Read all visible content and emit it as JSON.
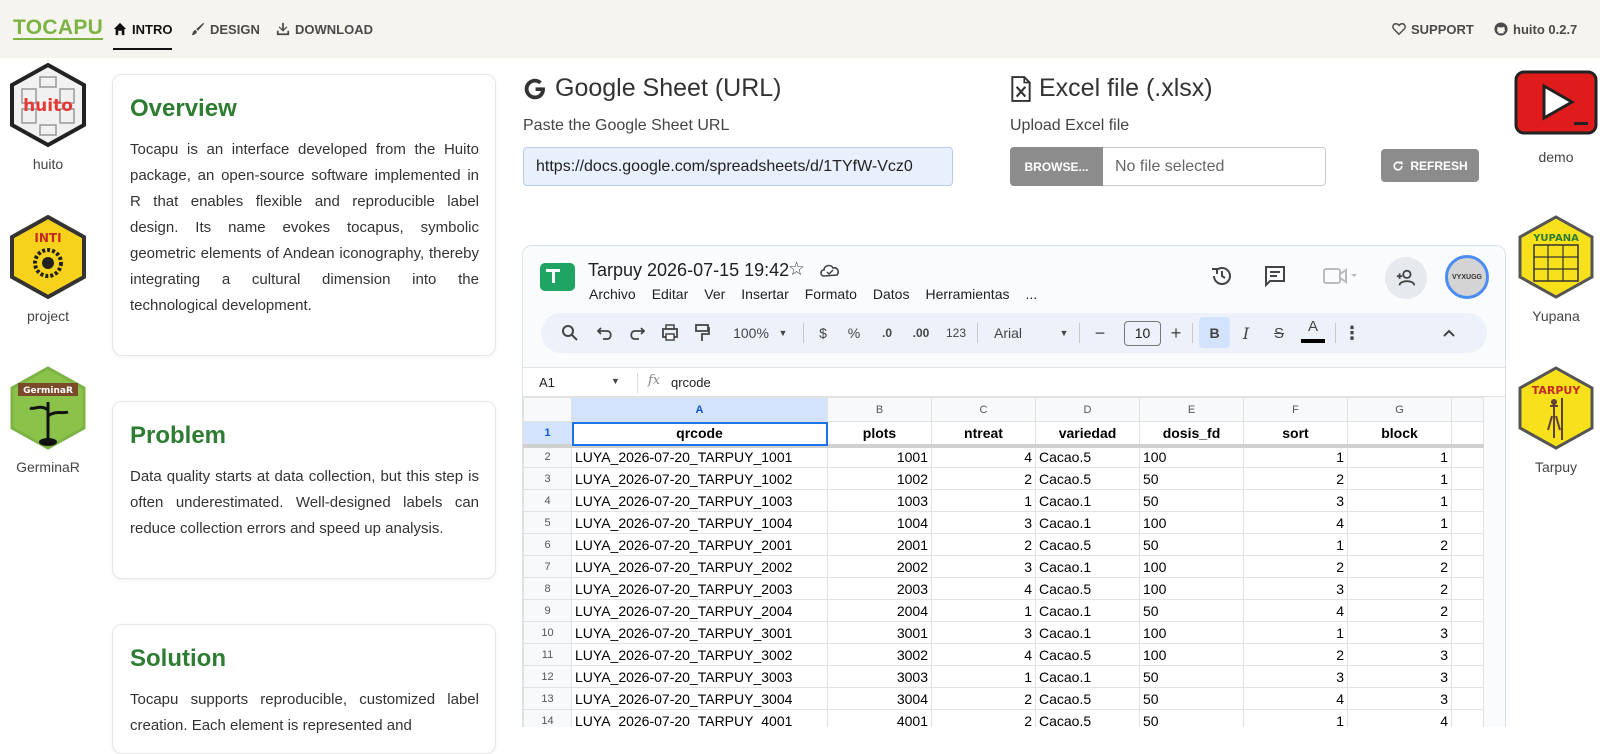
{
  "nav": {
    "brand": "TOCAPU",
    "items": [
      {
        "label": "INTRO",
        "icon": "home-icon"
      },
      {
        "label": "DESIGN",
        "icon": "brush-icon"
      },
      {
        "label": "DOWNLOAD",
        "icon": "download-icon"
      }
    ],
    "support": "SUPPORT",
    "version": "huito 0.2.7"
  },
  "left_logos": [
    {
      "label": "huito",
      "logo_text": "huito"
    },
    {
      "label": "project",
      "logo_text": "INTI"
    },
    {
      "label": "GerminaR",
      "logo_text": "GerminaR"
    }
  ],
  "right_logos": [
    {
      "label": "demo"
    },
    {
      "label": "Yupana",
      "logo_text": "YUPANA"
    },
    {
      "label": "Tarpuy",
      "logo_text": "TARPUY"
    }
  ],
  "cards": [
    {
      "title": "Overview",
      "body": "Tocapu is an interface developed from the Huito package, an open-source software implemented in R that enables flexible and reproducible label design. Its name evokes tocapus, symbolic geometric elements of Andean iconography, thereby integrating a cultural dimension into the technological development."
    },
    {
      "title": "Problem",
      "body": "Data quality starts at data collection, but this step is often underestimated. Well-designed labels can reduce collection errors and speed up analysis."
    },
    {
      "title": "Solution",
      "body": "Tocapu supports reproducible, customized label creation. Each element is represented and"
    }
  ],
  "google_sheet": {
    "title": "Google Sheet (URL)",
    "label": "Paste the Google Sheet URL",
    "value": "https://docs.google.com/spreadsheets/d/1TYfW-Vcz0"
  },
  "excel": {
    "title": "Excel file (.xlsx)",
    "label": "Upload Excel file",
    "browse": "BROWSE...",
    "placeholder": "No file selected",
    "refresh": "REFRESH"
  },
  "sheet": {
    "doc_title": "Tarpuy 2026-07-15  19:42",
    "menu": [
      "Archivo",
      "Editar",
      "Ver",
      "Insertar",
      "Formato",
      "Datos",
      "Herramientas",
      "..."
    ],
    "toolbar": {
      "zoom": "100%",
      "currency": "$",
      "percent": "%",
      "dec_less": ".0",
      "dec_more": ".00",
      "format_123": "123",
      "font": "Arial",
      "font_size": "10",
      "bold": "B",
      "italic": "I",
      "strike": "S",
      "text_color": "A"
    },
    "avatar_text": "VYXUGG",
    "name_box": "A1",
    "formula": "qrcode",
    "columns": [
      "A",
      "B",
      "C",
      "D",
      "E",
      "F",
      "G"
    ],
    "header": [
      "qrcode",
      "plots",
      "ntreat",
      "variedad",
      "dosis_fd",
      "sort",
      "block"
    ],
    "rows": [
      [
        "2",
        "LUYA_2026-07-20_TARPUY_1001",
        "1001",
        "4",
        "Cacao.5",
        "100",
        "1",
        "1"
      ],
      [
        "3",
        "LUYA_2026-07-20_TARPUY_1002",
        "1002",
        "2",
        "Cacao.5",
        "50",
        "2",
        "1"
      ],
      [
        "4",
        "LUYA_2026-07-20_TARPUY_1003",
        "1003",
        "1",
        "Cacao.1",
        "50",
        "3",
        "1"
      ],
      [
        "5",
        "LUYA_2026-07-20_TARPUY_1004",
        "1004",
        "3",
        "Cacao.1",
        "100",
        "4",
        "1"
      ],
      [
        "6",
        "LUYA_2026-07-20_TARPUY_2001",
        "2001",
        "2",
        "Cacao.5",
        "50",
        "1",
        "2"
      ],
      [
        "7",
        "LUYA_2026-07-20_TARPUY_2002",
        "2002",
        "3",
        "Cacao.1",
        "100",
        "2",
        "2"
      ],
      [
        "8",
        "LUYA_2026-07-20_TARPUY_2003",
        "2003",
        "4",
        "Cacao.5",
        "100",
        "3",
        "2"
      ],
      [
        "9",
        "LUYA_2026-07-20_TARPUY_2004",
        "2004",
        "1",
        "Cacao.1",
        "50",
        "4",
        "2"
      ],
      [
        "10",
        "LUYA_2026-07-20_TARPUY_3001",
        "3001",
        "3",
        "Cacao.1",
        "100",
        "1",
        "3"
      ],
      [
        "11",
        "LUYA_2026-07-20_TARPUY_3002",
        "3002",
        "4",
        "Cacao.5",
        "100",
        "2",
        "3"
      ],
      [
        "12",
        "LUYA_2026-07-20_TARPUY_3003",
        "3003",
        "1",
        "Cacao.1",
        "50",
        "3",
        "3"
      ],
      [
        "13",
        "LUYA_2026-07-20_TARPUY_3004",
        "3004",
        "2",
        "Cacao.5",
        "50",
        "4",
        "3"
      ],
      [
        "14",
        "LUYA_2026-07-20_TARPUY_4001",
        "4001",
        "2",
        "Cacao.5",
        "50",
        "1",
        "4"
      ]
    ]
  },
  "colors": {
    "brand": "#7cb342",
    "heading": "#2e7d32",
    "button_gray": "#8c8c8c",
    "youtube_red": "#e01b1b"
  }
}
